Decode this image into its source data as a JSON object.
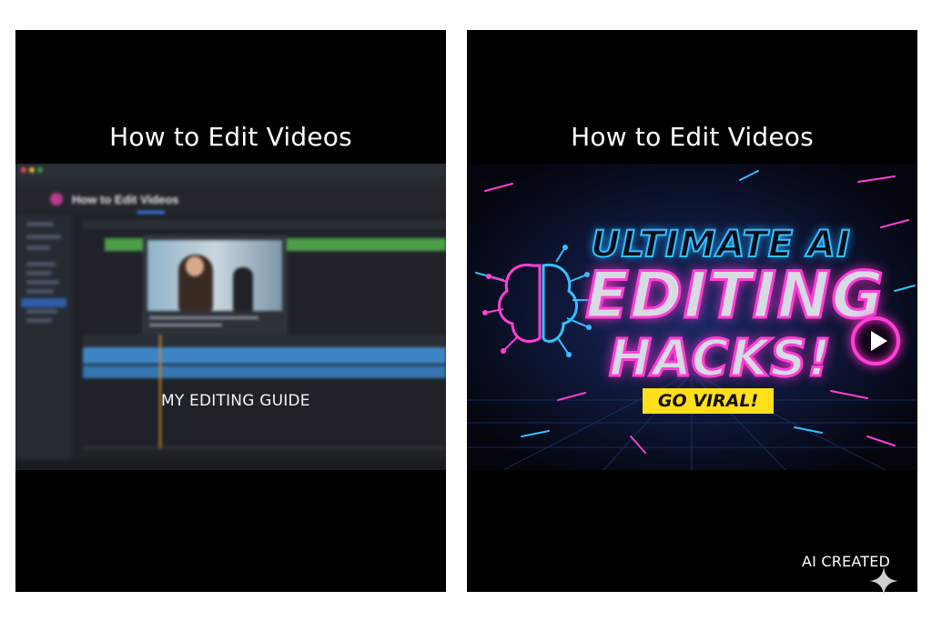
{
  "left_panel": {
    "title": "How to Edit Videos",
    "editor": {
      "window_title": "How to Edit Videos"
    },
    "overlay_caption": "MY EDITING GUIDE"
  },
  "right_panel": {
    "title": "How to Edit Videos",
    "thumbnail": {
      "line1": "ULTIMATE AI",
      "line2": "EDITING",
      "line3": "HACKS!",
      "badge": "GO VIRAL!"
    },
    "watermark": "AI CREATED"
  },
  "colors": {
    "neon_pink": "#ff3fd5",
    "neon_blue": "#31c2ff",
    "badge_yellow": "#ffde1a",
    "timeline_green": "#4c9e48",
    "timeline_blue": "#3d86c6",
    "playhead_orange": "#d58a2a"
  },
  "icons": [
    "brain-circuit-icon",
    "play-icon",
    "sparkle-icon"
  ]
}
